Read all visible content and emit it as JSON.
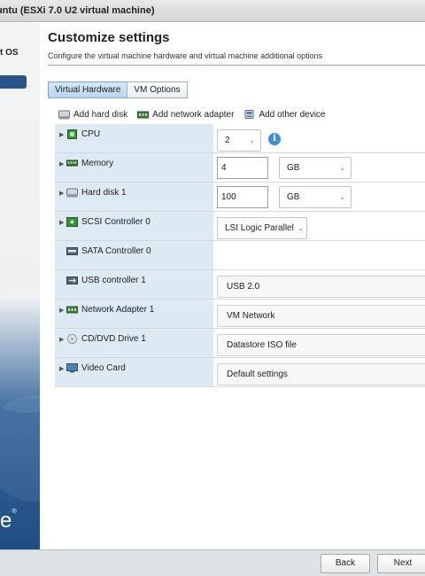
{
  "window": {
    "title": "untu (ESXi 7.0 U2 virtual machine)"
  },
  "sidebar": {
    "step_partial": "t OS",
    "brand_partial": "e"
  },
  "page": {
    "title": "Customize settings",
    "subtitle": "Configure the virtual machine hardware and virtual machine additional options"
  },
  "tabs": [
    {
      "label": "Virtual Hardware",
      "active": true
    },
    {
      "label": "VM Options",
      "active": false
    }
  ],
  "toolbar": {
    "add_hard_disk": "Add hard disk",
    "add_network_adapter": "Add network adapter",
    "add_other_device": "Add other device"
  },
  "devices": {
    "cpu": {
      "label": "CPU",
      "value": "2"
    },
    "memory": {
      "label": "Memory",
      "value": "4",
      "unit": "GB"
    },
    "hard_disk": {
      "label": "Hard disk 1",
      "value": "100",
      "unit": "GB"
    },
    "scsi": {
      "label": "SCSI Controller 0",
      "value": "LSI Logic Parallel"
    },
    "sata": {
      "label": "SATA Controller 0"
    },
    "usb": {
      "label": "USB controller 1",
      "value": "USB 2.0"
    },
    "network": {
      "label": "Network Adapter 1",
      "value": "VM Network"
    },
    "cdrom": {
      "label": "CD/DVD Drive 1",
      "value": "Datastore ISO file"
    },
    "video": {
      "label": "Video Card",
      "value": "Default settings"
    }
  },
  "footer": {
    "back": "Back",
    "next": "Next"
  },
  "colors": {
    "accent": "#2a5389",
    "tab_active": "#c9e0f4",
    "row_label_bg": "#dde9f3",
    "info": "#3f8edb"
  }
}
